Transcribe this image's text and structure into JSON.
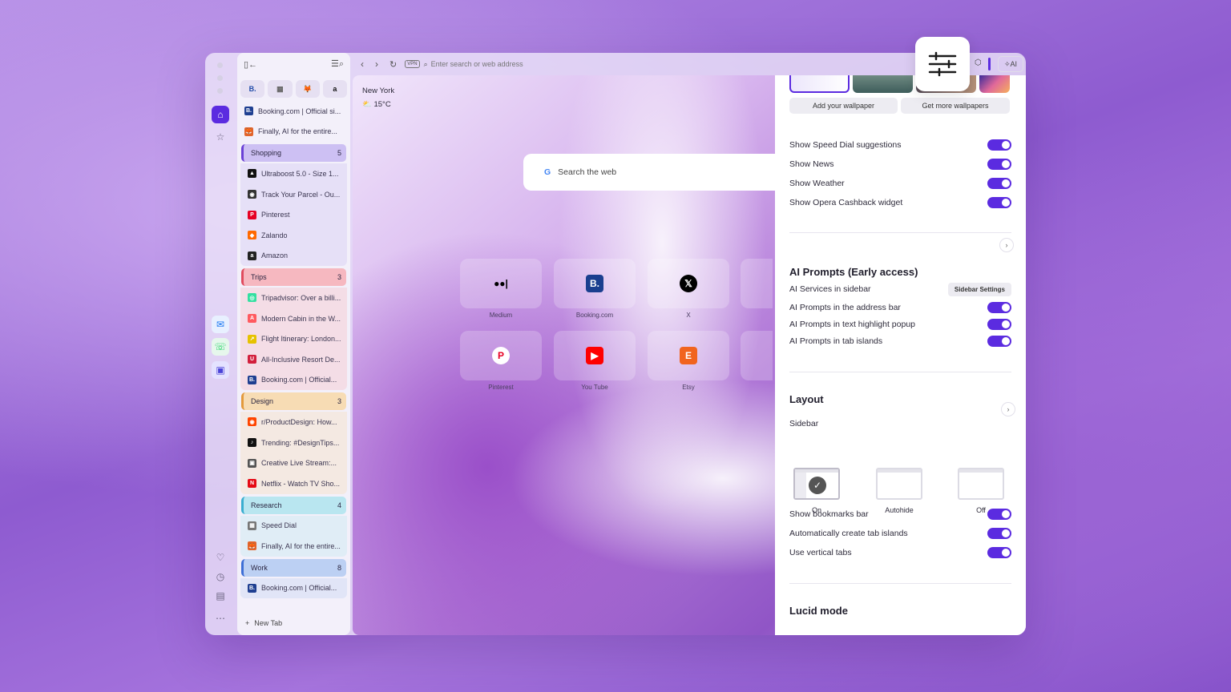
{
  "sidebar": {
    "top_icons": [
      "home-icon",
      "star-icon"
    ],
    "mid_icons": [
      "messenger-icon",
      "whatsapp-icon",
      "player-icon"
    ],
    "bottom_icons": [
      "heart-icon",
      "clock-icon",
      "gift-icon",
      "more-icon"
    ]
  },
  "tabs": {
    "pinned": [
      {
        "glyph": "B.",
        "color": "#1f4aa8"
      },
      {
        "glyph": "▦",
        "color": "#666"
      },
      {
        "glyph": "🦊",
        "color": "#e2642b"
      },
      {
        "glyph": "a",
        "color": "#111"
      }
    ],
    "loose": [
      {
        "title": "Booking.com | Official si...",
        "fav": "B.",
        "color": "#1f3f91"
      },
      {
        "title": "Finally, AI for the entire...",
        "fav": "🦊",
        "color": "#e2642b"
      }
    ],
    "groups": [
      {
        "name": "Shopping",
        "count": "5",
        "bg": "#cdc0f3",
        "border": "#6a41d6",
        "items": [
          {
            "title": "Ultraboost 5.0 - Size 1...",
            "fav": "▲",
            "color": "#111"
          },
          {
            "title": "Track Your Parcel - Ou...",
            "fav": "◉",
            "color": "#333"
          },
          {
            "title": "Pinterest",
            "fav": "P",
            "color": "#e60023"
          },
          {
            "title": "Zalando",
            "fav": "◆",
            "color": "#ff6900"
          },
          {
            "title": "Amazon",
            "fav": "a",
            "color": "#222"
          }
        ]
      },
      {
        "name": "Trips",
        "count": "3",
        "bg": "#f6b8c0",
        "border": "#e04c5e",
        "items": [
          {
            "title": "Tripadvisor: Over a billi...",
            "fav": "◎",
            "color": "#34e0a1"
          },
          {
            "title": "Modern Cabin in the W...",
            "fav": "A",
            "color": "#ff5a5f"
          },
          {
            "title": "Flight Itinerary: London...",
            "fav": "↗",
            "color": "#e6c200"
          },
          {
            "title": "All-Inclusive Resort De...",
            "fav": "U",
            "color": "#d21f3c"
          },
          {
            "title": "Booking.com | Official...",
            "fav": "B.",
            "color": "#1f3f91"
          }
        ]
      },
      {
        "name": "Design",
        "count": "3",
        "bg": "#f7dcb4",
        "border": "#e39a3c",
        "items": [
          {
            "title": "r/ProductDesign: How...",
            "fav": "◉",
            "color": "#ff4500"
          },
          {
            "title": "Trending: #DesignTips...",
            "fav": "♪",
            "color": "#111"
          },
          {
            "title": "Creative Live Stream:...",
            "fav": "▣",
            "color": "#555"
          },
          {
            "title": "Netflix - Watch TV Sho...",
            "fav": "N",
            "color": "#e50914"
          }
        ]
      },
      {
        "name": "Research",
        "count": "4",
        "bg": "#b9e6f0",
        "border": "#3aaed0",
        "items": [
          {
            "title": "Speed Dial",
            "fav": "▦",
            "color": "#777"
          },
          {
            "title": "Finally, AI for the entire...",
            "fav": "🦊",
            "color": "#e2642b"
          }
        ]
      },
      {
        "name": "Work",
        "count": "8",
        "bg": "#bcd0f3",
        "border": "#3e6fd6",
        "items": [
          {
            "title": "Booking.com | Official...",
            "fav": "B.",
            "color": "#1f3f91"
          }
        ]
      }
    ],
    "new_tab": "New Tab"
  },
  "addressbar": {
    "vpn": "VPN",
    "placeholder": "Enter search or web address",
    "ai": "AI"
  },
  "weather": {
    "city": "New York",
    "temp": "15°C"
  },
  "search": {
    "placeholder": "Search the web"
  },
  "speed_dial": [
    {
      "label": "Medium",
      "glyph": "●●|",
      "color": "#000",
      "bg": "transparent"
    },
    {
      "label": "Booking.com",
      "glyph": "B.",
      "color": "#fff",
      "bg": "#1a3f8f"
    },
    {
      "label": "X",
      "glyph": "𝕏",
      "color": "#fff",
      "bg": "#000"
    },
    {
      "label": "Pinterest",
      "glyph": "P",
      "color": "#e60023",
      "bg": "#fff"
    },
    {
      "label": "You Tube",
      "glyph": "▶",
      "color": "#fff",
      "bg": "#ff0000"
    },
    {
      "label": "Etsy",
      "glyph": "E",
      "color": "#fff",
      "bg": "#f1641e"
    }
  ],
  "settings": {
    "wallpaper_add": "Add your wallpaper",
    "wallpaper_more": "Get more wallpapers",
    "toggles1": [
      "Show Speed Dial suggestions",
      "Show News",
      "Show Weather",
      "Show Opera Cashback widget"
    ],
    "ai_title": "AI Prompts (Early access)",
    "ai_services": "AI Services in sidebar",
    "sidebar_settings": "Sidebar Settings",
    "ai_toggles": [
      "AI Prompts in the address bar",
      "AI Prompts in text highlight popup",
      "AI Prompts in tab islands"
    ],
    "layout_title": "Layout",
    "sidebar_label": "Sidebar",
    "layout_options": [
      "On",
      "Autohide",
      "Off"
    ],
    "toggles2": [
      "Show bookmarks bar",
      "Automatically create tab islands",
      "Use vertical tabs"
    ],
    "lucid_title": "Lucid mode"
  }
}
